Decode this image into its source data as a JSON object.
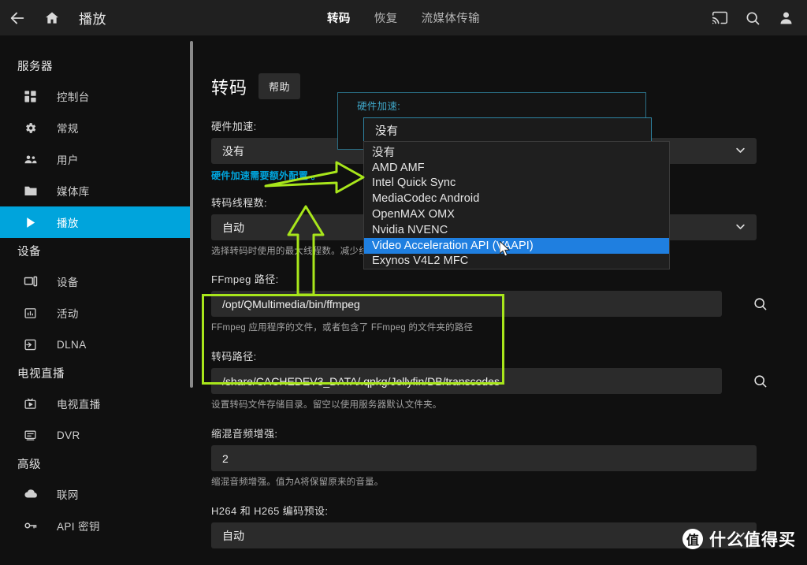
{
  "topbar": {
    "back_icon": "arrow-left-icon",
    "home_icon": "home-icon",
    "title": "播放",
    "tabs": [
      {
        "label": "转码",
        "active": true
      },
      {
        "label": "恢复",
        "active": false
      },
      {
        "label": "流媒体传输",
        "active": false
      }
    ],
    "right_icons": [
      "cast-icon",
      "search-icon",
      "account-icon"
    ]
  },
  "sidebar": {
    "sections": [
      {
        "title": "服务器",
        "items": [
          {
            "label": "控制台",
            "icon": "dashboard-icon",
            "active": false
          },
          {
            "label": "常规",
            "icon": "gear-icon",
            "active": false
          },
          {
            "label": "用户",
            "icon": "users-icon",
            "active": false
          },
          {
            "label": "媒体库",
            "icon": "folder-icon",
            "active": false
          },
          {
            "label": "播放",
            "icon": "play-icon",
            "active": true
          }
        ]
      },
      {
        "title": "设备",
        "items": [
          {
            "label": "设备",
            "icon": "device-icon",
            "active": false
          },
          {
            "label": "活动",
            "icon": "activity-icon",
            "active": false
          },
          {
            "label": "DLNA",
            "icon": "dlna-icon",
            "active": false
          }
        ]
      },
      {
        "title": "电视直播",
        "items": [
          {
            "label": "电视直播",
            "icon": "livetv-icon",
            "active": false
          },
          {
            "label": "DVR",
            "icon": "dvr-icon",
            "active": false
          }
        ]
      },
      {
        "title": "高级",
        "items": [
          {
            "label": "联网",
            "icon": "cloud-icon",
            "active": false
          },
          {
            "label": "API 密钥",
            "icon": "key-icon",
            "active": false
          }
        ]
      }
    ]
  },
  "page": {
    "title": "转码",
    "help_button": "帮助",
    "fields": {
      "hwaccel": {
        "label": "硬件加速:",
        "value": "没有",
        "link": "硬件加速需要额外配置 。"
      },
      "threads": {
        "label": "转码线程数:",
        "value": "自动",
        "help": "选择转码时使用的最大线程数。减少线程数量将会降低CPU使用率，可能无法快速进行转换并流畅的播放。"
      },
      "ffmpeg_path": {
        "label": "FFmpeg 路径:",
        "value": "/opt/QMultimedia/bin/ffmpeg",
        "help": "FFmpeg 应用程序的文件，或者包含了 FFmpeg 的文件夹的路径",
        "search_icon": "search-icon"
      },
      "transcode_path": {
        "label": "转码路径:",
        "value": "/share/CACHEDEV3_DATA/.qpkg/Jellyfin/DB/transcodes",
        "help": "设置转码文件存储目录。留空以使用服务器默认文件夹。",
        "search_icon": "search-icon"
      },
      "downmix": {
        "label": "缩混音频增强:",
        "value": "2",
        "help": "缩混音频增强。值为A将保留原来的音量。"
      },
      "encoder_preset": {
        "label": "H264 和 H265 编码预设:",
        "value": "自动"
      }
    }
  },
  "dropdown": {
    "label": "硬件加速:",
    "input_value": "没有",
    "options": [
      {
        "label": "没有",
        "selected": false
      },
      {
        "label": "AMD AMF",
        "selected": false
      },
      {
        "label": "Intel Quick Sync",
        "selected": false
      },
      {
        "label": "MediaCodec Android",
        "selected": false
      },
      {
        "label": "OpenMAX OMX",
        "selected": false
      },
      {
        "label": "Nvidia NVENC",
        "selected": false
      },
      {
        "label": "Video Acceleration API (VAAPI)",
        "selected": true
      },
      {
        "label": "Exynos V4L2 MFC",
        "selected": false
      }
    ]
  },
  "annotations": {
    "color": "#a8e61b",
    "arrow_right": "arrow-right-annotation",
    "arrow_up": "arrow-up-annotation",
    "highlight_box": "ffmpeg-path-highlight-box"
  },
  "watermark": {
    "badge": "值",
    "text": "什么值得买"
  },
  "colors": {
    "accent": "#00a4dc",
    "selection": "#1f7fe0",
    "annotation": "#a8e61b",
    "background": "#101010",
    "topbar": "#202020"
  }
}
